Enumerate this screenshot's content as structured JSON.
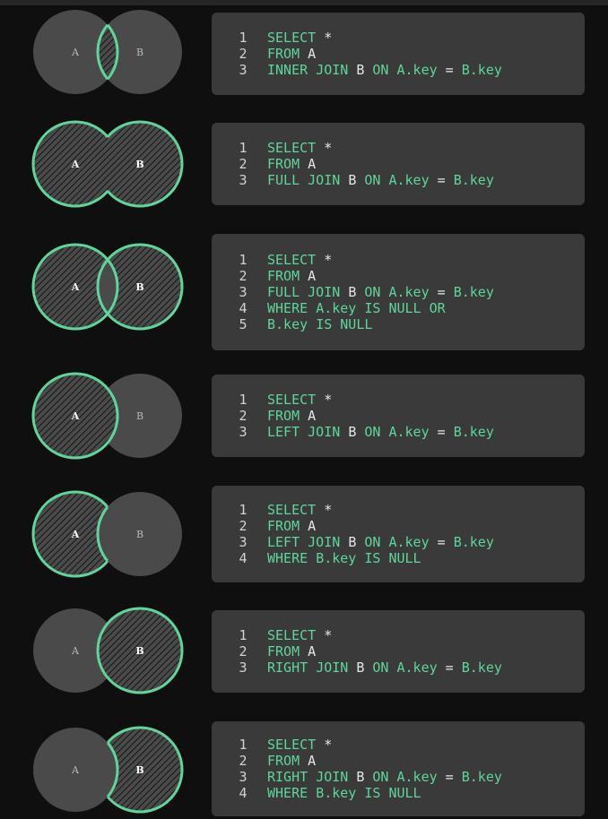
{
  "colors": {
    "background": "#0f0f0f",
    "panel": "#3a3a3a",
    "circle_fill": "#4a4a4a",
    "highlight": "#5ed59a",
    "keyword": "#5ed59a",
    "line_number": "#d2d2d2"
  },
  "joins": [
    {
      "venn": {
        "label_a": "A",
        "label_b": "B",
        "region": "inner"
      },
      "code": [
        {
          "n": "1",
          "text": "SELECT *"
        },
        {
          "n": "2",
          "text": "FROM A"
        },
        {
          "n": "3",
          "text": "INNER JOIN B ON A.key = B.key"
        }
      ]
    },
    {
      "venn": {
        "label_a": "A",
        "label_b": "B",
        "region": "full"
      },
      "code": [
        {
          "n": "1",
          "text": "SELECT *"
        },
        {
          "n": "2",
          "text": "FROM A"
        },
        {
          "n": "3",
          "text": "FULL JOIN B ON A.key = B.key"
        }
      ]
    },
    {
      "venn": {
        "label_a": "A",
        "label_b": "B",
        "region": "full-excluding-inner"
      },
      "code": [
        {
          "n": "1",
          "text": "SELECT *"
        },
        {
          "n": "2",
          "text": "FROM A"
        },
        {
          "n": "3",
          "text": "FULL JOIN B ON A.key = B.key"
        },
        {
          "n": "4",
          "text": "WHERE A.key IS NULL OR"
        },
        {
          "n": "5",
          "text": "B.key IS NULL"
        }
      ]
    },
    {
      "venn": {
        "label_a": "A",
        "label_b": "B",
        "region": "left"
      },
      "code": [
        {
          "n": "1",
          "text": "SELECT *"
        },
        {
          "n": "2",
          "text": "FROM A"
        },
        {
          "n": "3",
          "text": "LEFT JOIN B ON A.key = B.key"
        }
      ]
    },
    {
      "venn": {
        "label_a": "A",
        "label_b": "B",
        "region": "left-excluding-inner"
      },
      "code": [
        {
          "n": "1",
          "text": "SELECT *"
        },
        {
          "n": "2",
          "text": "FROM A"
        },
        {
          "n": "3",
          "text": "LEFT JOIN B ON A.key = B.key"
        },
        {
          "n": "4",
          "text": "WHERE B.key IS NULL"
        }
      ]
    },
    {
      "venn": {
        "label_a": "A",
        "label_b": "B",
        "region": "right"
      },
      "code": [
        {
          "n": "1",
          "text": "SELECT *"
        },
        {
          "n": "2",
          "text": "FROM A"
        },
        {
          "n": "3",
          "text": "RIGHT JOIN B ON A.key = B.key"
        }
      ]
    },
    {
      "venn": {
        "label_a": "A",
        "label_b": "B",
        "region": "right-excluding-inner"
      },
      "code": [
        {
          "n": "1",
          "text": "SELECT *"
        },
        {
          "n": "2",
          "text": "FROM A"
        },
        {
          "n": "3",
          "text": "RIGHT JOIN B ON A.key = B.key"
        },
        {
          "n": "4",
          "text": "WHERE B.key IS NULL"
        }
      ]
    }
  ]
}
